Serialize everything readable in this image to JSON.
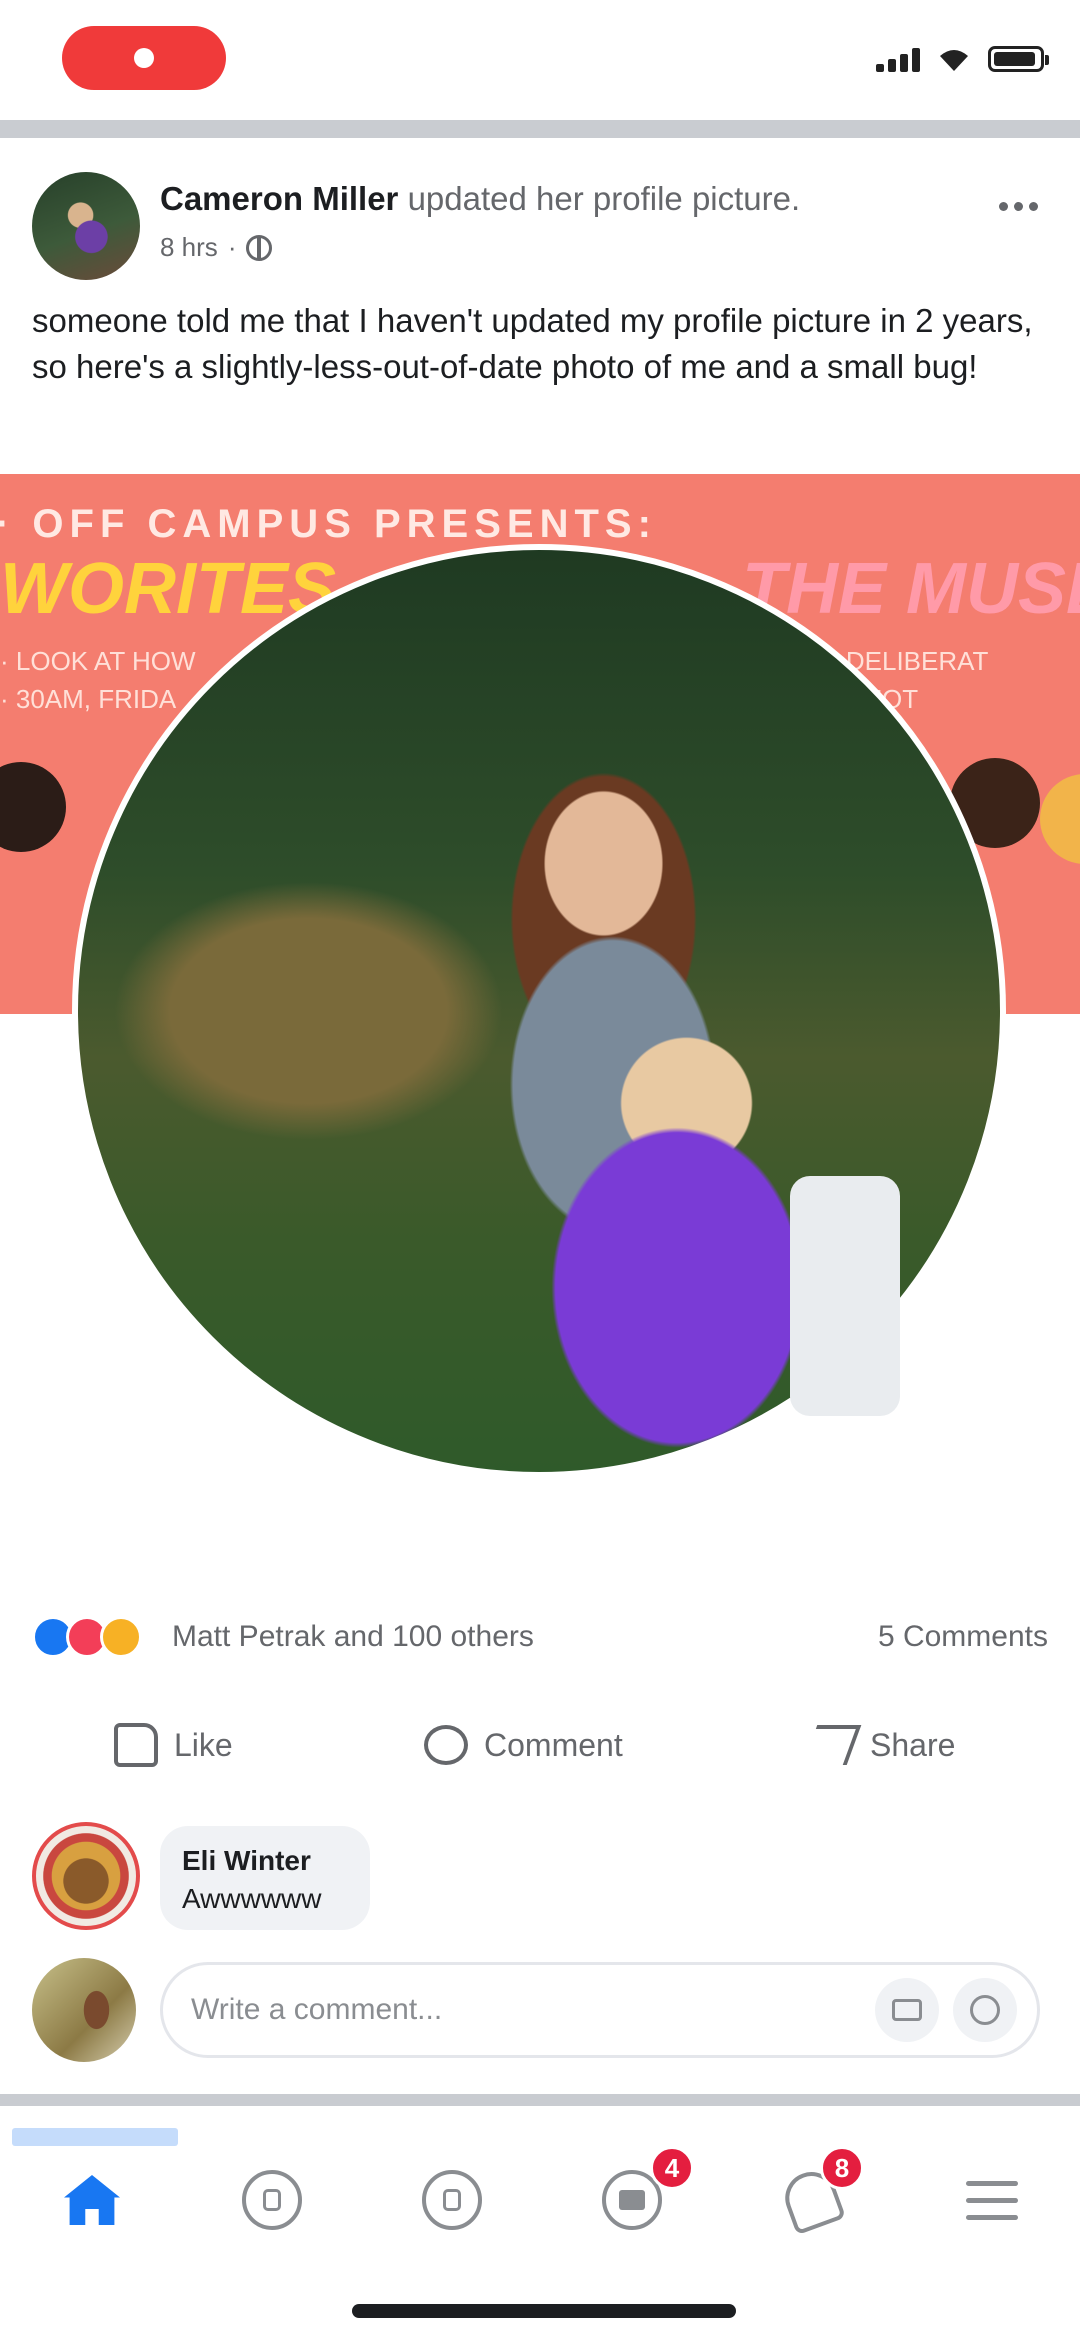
{
  "post": {
    "author": "Cameron Miller",
    "action": " updated her profile picture.",
    "time": "8 hrs",
    "text": "someone told me that I haven't updated my profile picture in 2 years, so here's a slightly-less-out-of-date photo of me and a small bug!"
  },
  "cover": {
    "top": "· OFF CAMPUS PRESENTS:",
    "headline_left": "WORITES",
    "headline_right": "THE MUSE",
    "sub1_left": "· LOOK AT HOW",
    "sub2_left": "· 30AM, FRIDA",
    "sub1_right": "· DELIBERAT",
    "sub2_right": "· DEOT"
  },
  "reactions": {
    "types": [
      "like",
      "love",
      "haha"
    ],
    "summary": "Matt Petrak and 100 others",
    "comments_count": "5 Comments"
  },
  "actions": {
    "like": "Like",
    "comment": "Comment",
    "share": "Share"
  },
  "comment": {
    "author": "Eli Winter",
    "text": "Awwwwww"
  },
  "composer": {
    "placeholder": "Write a comment..."
  },
  "nav": {
    "active": "home",
    "marketplace_badge": "4",
    "notifications_badge": "8"
  },
  "colors": {
    "accent": "#1877f2",
    "cover_bg": "#f47d6f",
    "badge": "#e41e3f"
  }
}
